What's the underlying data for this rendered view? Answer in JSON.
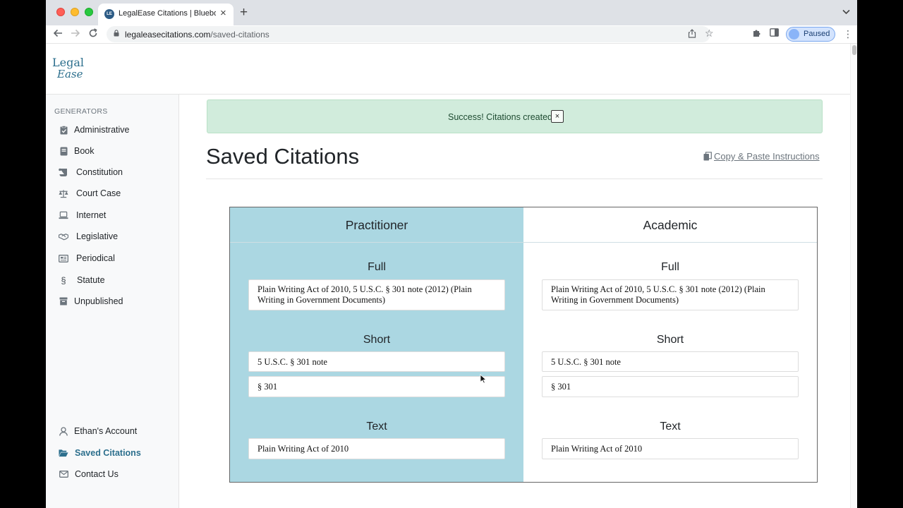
{
  "browser": {
    "tab_title": "LegalEase Citations | Bluebook",
    "tab_favicon_text": "LE",
    "url_host": "legaleasecitations.com",
    "url_path": "/saved-citations",
    "profile_label": "Paused"
  },
  "site": {
    "logo_line1": "Legal",
    "logo_line2": "Ease"
  },
  "sidebar": {
    "heading": "GENERATORS",
    "items": [
      {
        "label": "Administrative",
        "icon": "clipboard-check-icon"
      },
      {
        "label": "Book",
        "icon": "book-icon"
      },
      {
        "label": "Constitution",
        "icon": "scroll-icon"
      },
      {
        "label": "Court Case",
        "icon": "scale-icon"
      },
      {
        "label": "Internet",
        "icon": "laptop-icon"
      },
      {
        "label": "Legislative",
        "icon": "handshake-icon"
      },
      {
        "label": "Periodical",
        "icon": "newspaper-icon"
      },
      {
        "label": "Statute",
        "icon": "section-sign-icon"
      },
      {
        "label": "Unpublished",
        "icon": "archive-icon"
      }
    ],
    "bottom_items": [
      {
        "label": "Ethan's Account",
        "icon": "user-icon"
      },
      {
        "label": "Saved Citations",
        "icon": "folder-open-icon",
        "active": true
      },
      {
        "label": "Contact Us",
        "icon": "envelope-icon"
      }
    ]
  },
  "alert": {
    "message": "Success! Citations created!",
    "close_label": "×"
  },
  "main": {
    "title": "Saved Citations",
    "copy_link": "Copy & Paste Instructions"
  },
  "citations": {
    "practitioner": {
      "heading": "Practitioner",
      "full_label": "Full",
      "full": "Plain Writing Act of 2010, 5 U.S.C. § 301 note (2012) (Plain Writing in Government Documents)",
      "short_label": "Short",
      "short_1": "5 U.S.C. § 301 note",
      "short_2": "§ 301",
      "text_label": "Text",
      "text": "Plain Writing Act of 2010"
    },
    "academic": {
      "heading": "Academic",
      "full_label": "Full",
      "full": "Plain Writing Act of 2010, 5 U.S.C. § 301 note (2012) (Plain Writing in Government Documents)",
      "short_label": "Short",
      "short_1": "5 U.S.C. § 301 note",
      "short_2": "§ 301",
      "text_label": "Text",
      "text": "Plain Writing Act of 2010"
    }
  },
  "colors": {
    "practitioner_bg": "#abd7e2",
    "alert_bg": "#d1ecdc",
    "brand": "#2c6f8d"
  }
}
